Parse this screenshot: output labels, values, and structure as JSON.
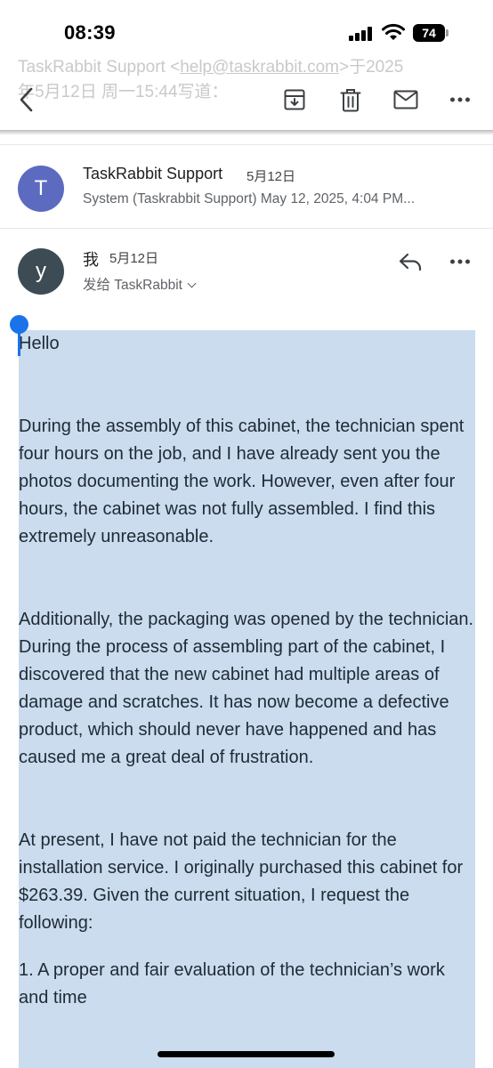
{
  "status_bar": {
    "time": "08:39",
    "battery": "74"
  },
  "header_faded": {
    "line1_prefix": "TaskRabbit Support <",
    "line1_addr": "help@taskrabbit.com",
    "line1_suffix": ">于2025",
    "line2": "年5月12日 周一15:44写道："
  },
  "toolbar": {
    "back_icon": "back-arrow-icon",
    "archive_icon": "archive-icon",
    "delete_icon": "trash-icon",
    "unread_icon": "mail-icon",
    "more_icon": "more-horizontal-icon"
  },
  "messages": [
    {
      "avatar_letter": "T",
      "sender": "TaskRabbit Support",
      "date": "5月12日",
      "snippet": "System (Taskrabbit Support) May 12, 2025, 4:04 PM..."
    },
    {
      "avatar_letter": "y",
      "sender": "我",
      "date": "5月12日",
      "recipient_line": "发给 TaskRabbit"
    }
  ],
  "email_body": {
    "greeting": "Hello",
    "paragraph1": "During the assembly of this cabinet, the technician spent four hours on the job, and I have already sent you the photos documenting the work. However, even after four hours, the cabinet was not fully assembled. I find this extremely unreasonable.",
    "paragraph2": "Additionally, the packaging was opened by the technician. During the process of assembling part of the cabinet, I discovered that the new cabinet had multiple areas of damage and scratches. It has now become a defective product, which should never have happened and has caused me a great deal of frustration.",
    "paragraph3": "At present, I have not paid the technician for the installation service. I originally purchased this cabinet for $263.39. Given the current situation, I request the following:",
    "list_item1": "1. A proper and fair evaluation of the technician’s work and time"
  },
  "colors": {
    "selection": "#cadcee",
    "handle": "#1a73e8",
    "avatar_t": "#5c6bc0",
    "avatar_y": "#3d4c54"
  }
}
